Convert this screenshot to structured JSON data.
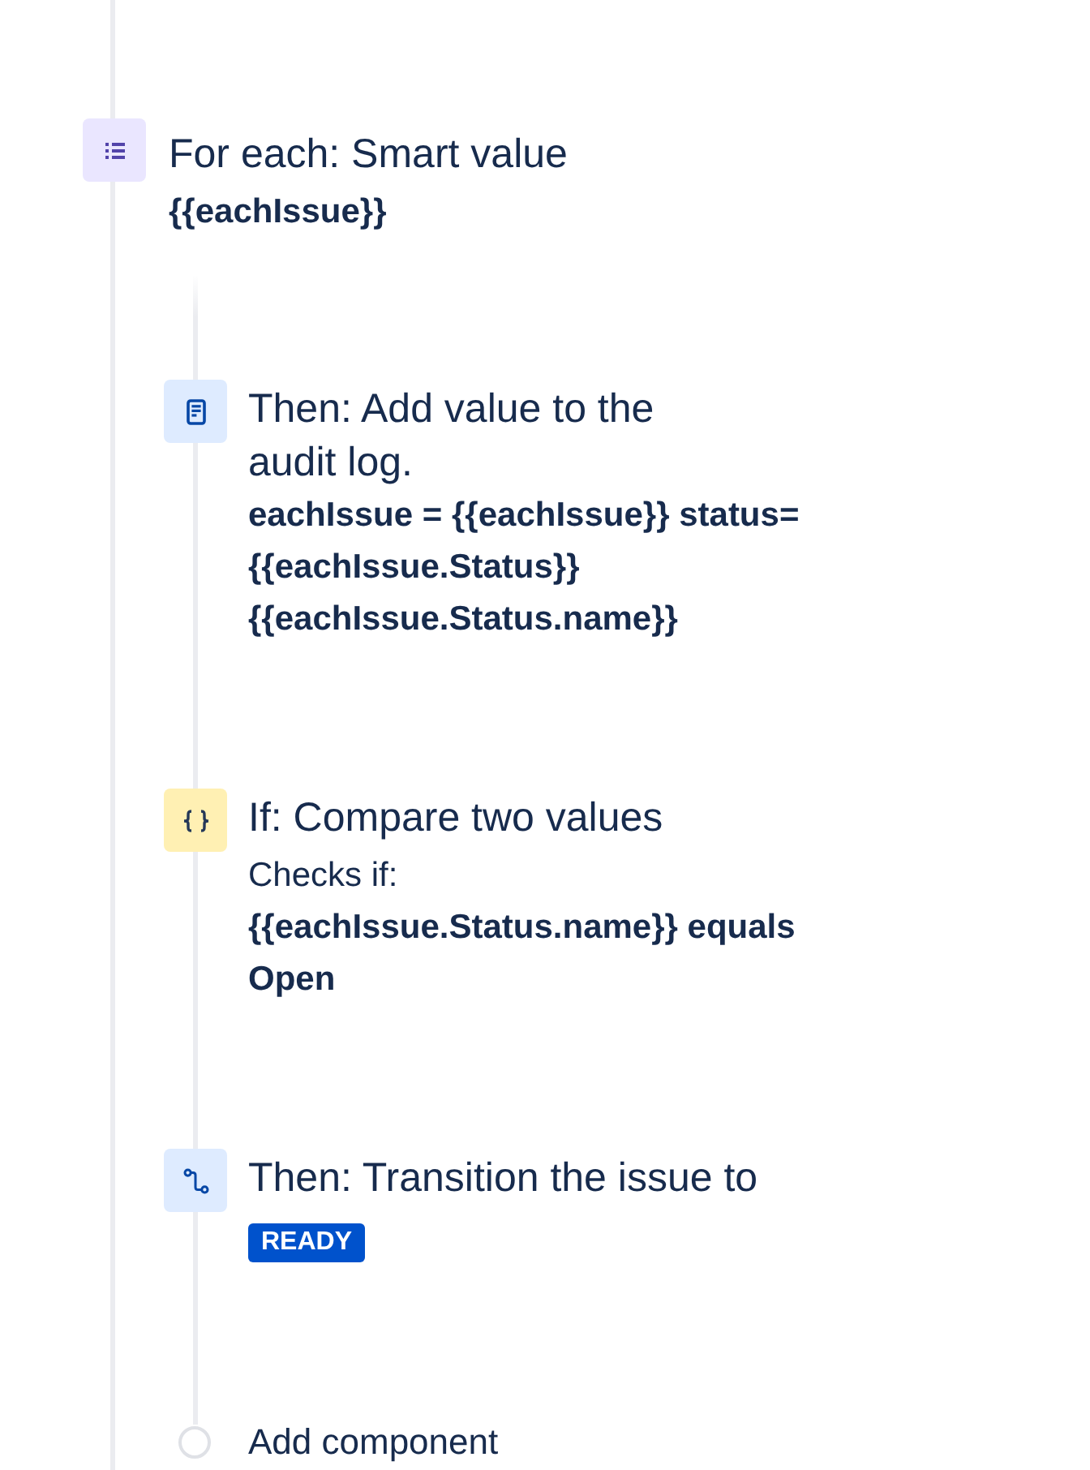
{
  "loop": {
    "title": "For each: Smart value",
    "smart_value": "{{eachIssue}}"
  },
  "steps": [
    {
      "kind": "log",
      "title": "Then: Add value to the audit log.",
      "detail": "eachIssue = {{eachIssue}} status= {{eachIssue.Status}} {{eachIssue.Status.name}}"
    },
    {
      "kind": "condition",
      "title": "If: Compare two values",
      "caption": "Checks if:",
      "detail": "{{eachIssue.Status.name}} equals Open"
    },
    {
      "kind": "transition",
      "title": "Then: Transition the issue to",
      "status_badge": "READY"
    }
  ],
  "add_component": {
    "label": "Add component"
  }
}
